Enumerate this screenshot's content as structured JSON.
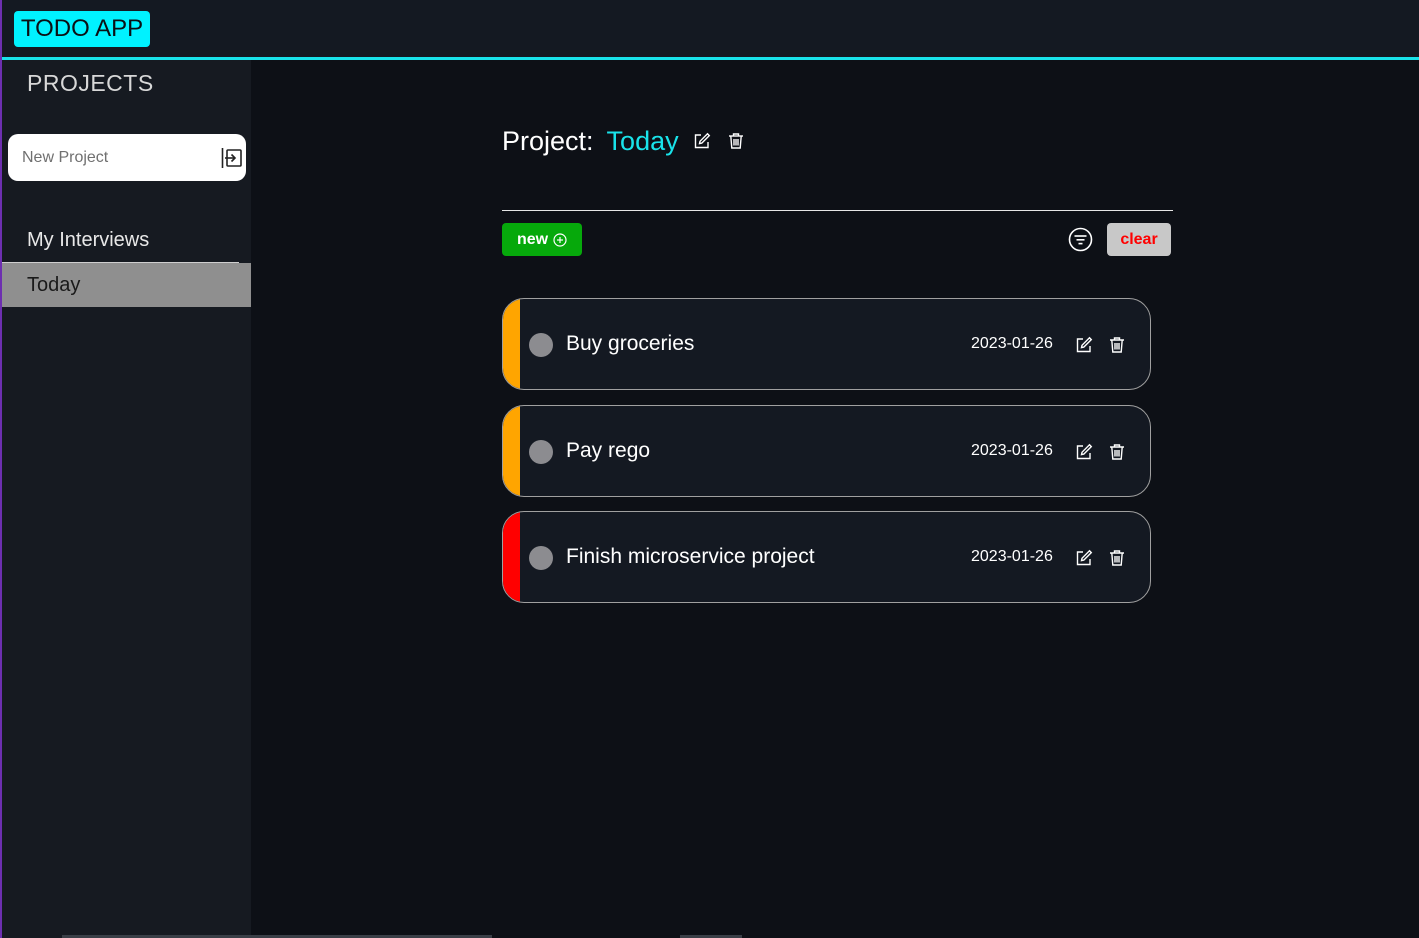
{
  "app": {
    "title": "TODO APP"
  },
  "sidebar": {
    "title": "PROJECTS",
    "new_project_placeholder": "New Project",
    "projects": [
      {
        "label": "My Interviews",
        "active": false
      },
      {
        "label": "Today",
        "active": true
      }
    ]
  },
  "main": {
    "project_label": "Project:",
    "project_name": "Today",
    "new_button_label": "new",
    "clear_button_label": "clear",
    "tasks": [
      {
        "title": "Buy groceries",
        "date": "2023-01-26",
        "priority_color": "#ffa500"
      },
      {
        "title": "Pay rego",
        "date": "2023-01-26",
        "priority_color": "#ffa500"
      },
      {
        "title": "Finish microservice project",
        "date": "2023-01-26",
        "priority_color": "#ff0000"
      }
    ]
  },
  "colors": {
    "accent": "#19e3ea",
    "new_button": "#06a90b",
    "clear_text": "#ff0000",
    "active_project_bg": "#8f8f8f"
  },
  "icons": {
    "submit_project": "enter-icon",
    "edit": "edit-icon",
    "delete": "trash-icon",
    "add": "plus-circle-icon",
    "filter": "filter-icon"
  }
}
